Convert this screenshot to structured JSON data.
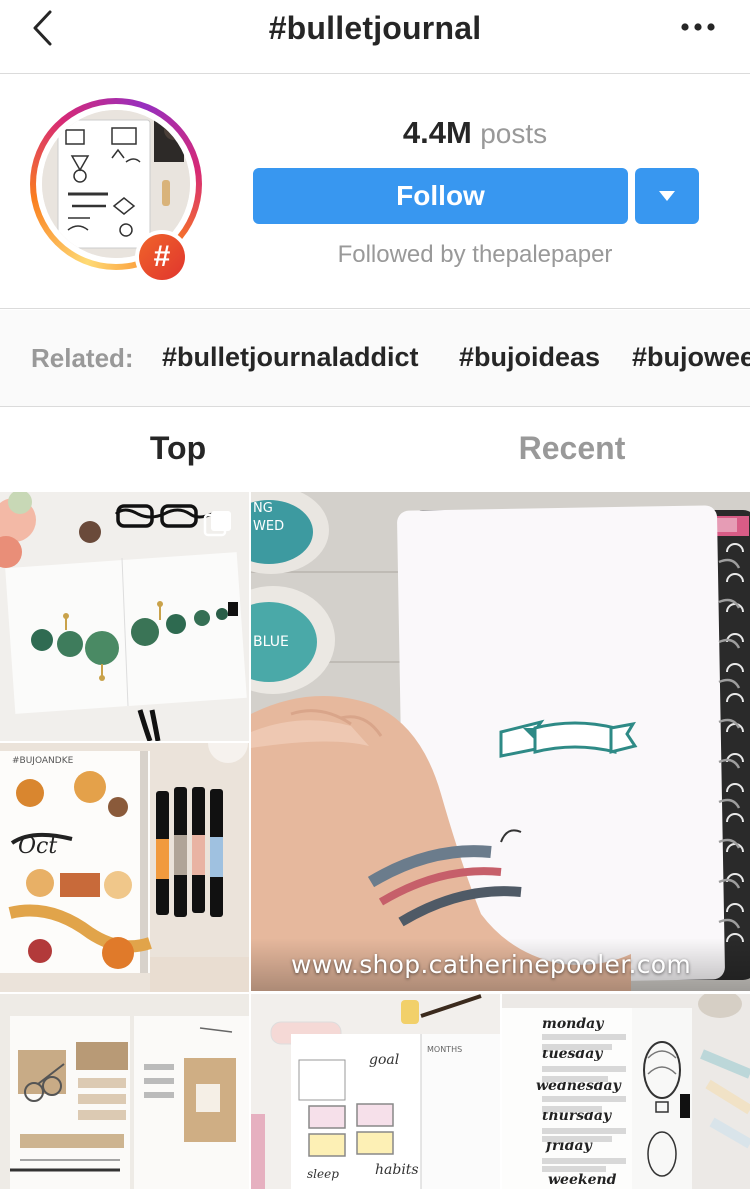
{
  "header": {
    "title": "#bulletjournal",
    "back_icon": "chevron-left-icon",
    "more_icon": "more-horizontal-icon"
  },
  "profile": {
    "posts_count": "4.4M",
    "posts_label": "posts",
    "follow_label": "Follow",
    "followed_by": "Followed by thepalepaper",
    "badge_symbol": "#",
    "accent_color": "#3897f0"
  },
  "related": {
    "label": "Related:",
    "tags": [
      "#bulletjournaladdict",
      "#bujoideas",
      "#bujoweek"
    ]
  },
  "tabs": [
    {
      "label": "Top",
      "active": true
    },
    {
      "label": "Recent",
      "active": false
    }
  ],
  "grid": {
    "video_watermark": "www.shop.catherinepooler.com",
    "photo_stamp_text": "#BUJOANDKE",
    "ink_labels": [
      "NG",
      "WED",
      "BLUE"
    ],
    "planner_words": [
      "goal",
      "habits",
      "sleep",
      "monday",
      "tuesday",
      "wednesday",
      "thursday",
      "friday",
      "weekend"
    ],
    "planner_heading": "MONTHS"
  }
}
